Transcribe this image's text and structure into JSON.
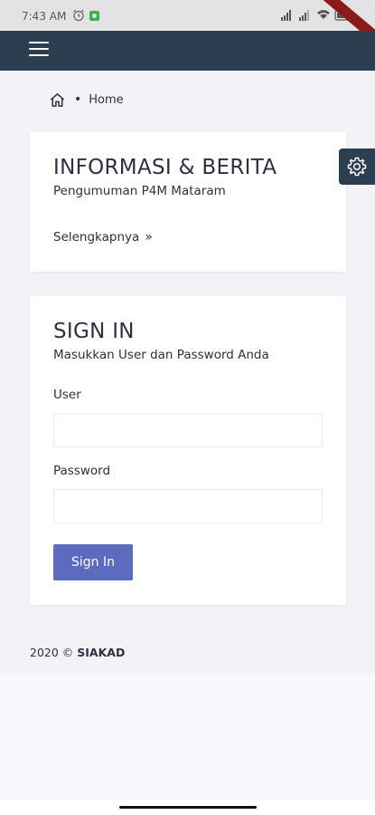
{
  "status_bar": {
    "time": "7:43 AM"
  },
  "breadcrumb": {
    "separator": "•",
    "label": "Home"
  },
  "news_card": {
    "title": "INFORMASI & BERITA",
    "subtitle": "Pengumuman P4M Mataram",
    "more_label": "Selengkapnya",
    "more_chevron": "»"
  },
  "signin_card": {
    "title": "SIGN IN",
    "subtitle": "Masukkan User dan Password Anda",
    "user_label": "User",
    "user_value": "",
    "password_label": "Password",
    "password_value": "",
    "button_label": "Sign In"
  },
  "footer": {
    "year": "2020 ©",
    "brand": "SIAKAD"
  },
  "colors": {
    "app_bar": "#2c3e50",
    "button": "#5c6bc0",
    "content_bg": "#f3f3f7"
  },
  "icons": {
    "menu": "hamburger-icon",
    "home": "home-icon",
    "settings": "gear-icon"
  }
}
